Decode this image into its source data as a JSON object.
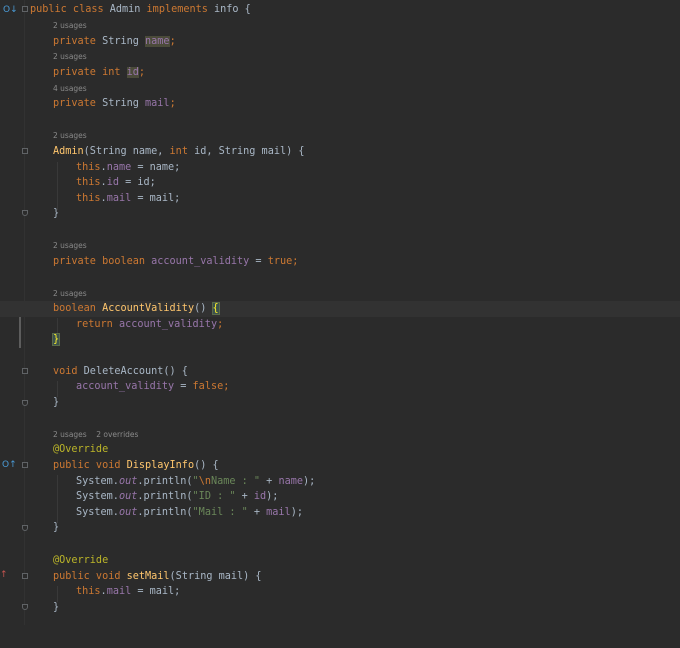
{
  "editor": {
    "hints": {
      "h1": "2 usages",
      "h2": "2 usages",
      "h3": "4 usages",
      "h4": "2 usages",
      "h5": "2 usages",
      "h6": "2 usages",
      "h7": "2 usages    2 overrides"
    },
    "code": {
      "l1_kw1": "public class ",
      "l1_name": "Admin ",
      "l1_kw2": "implements ",
      "l1_rest": "info {",
      "l2_kw": "private ",
      "l2_type": "String ",
      "l2_fld": "name",
      "l2_end": ";",
      "l3_kw": "private int ",
      "l3_fld": "id",
      "l3_end": ";",
      "l4_kw": "private ",
      "l4_type": "String ",
      "l4_fld": "mail",
      "l4_end": ";",
      "l5_fn": "Admin",
      "l5_a": "(String name, ",
      "l5_kw": "int ",
      "l5_b": "id, String mail) {",
      "l6_this": "this",
      "l6_dot": ".",
      "l6_fld": "name",
      "l6_rest": " = name;",
      "l7_this": "this",
      "l7_dot": ".",
      "l7_fld": "id",
      "l7_rest": " = id;",
      "l8_this": "this",
      "l8_dot": ".",
      "l8_fld": "mail",
      "l8_rest": " = mail;",
      "l9": "}",
      "l10_kw": "private boolean ",
      "l10_fld": "account_validity",
      "l10_eq": " = ",
      "l10_val": "true",
      "l10_end": ";",
      "l11_kw": "boolean ",
      "l11_fn": "AccountValidity",
      "l11_a": "() ",
      "l11_brace": "{",
      "l12_kw": "return ",
      "l12_fld": "account_validity",
      "l12_end": ";",
      "l13_brace": "}",
      "l14_kw": "void ",
      "l14_fn": "DeleteAccount",
      "l14_a": "() {",
      "l15_fld": "account_validity",
      "l15_eq": " = ",
      "l15_val": "false",
      "l15_end": ";",
      "l16": "}",
      "l17_ann": "@Override",
      "l18_kw": "public void ",
      "l18_fn": "DisplayInfo",
      "l18_a": "() {",
      "l19_sys": "System.",
      "l19_out": "out",
      "l19_p": ".println(",
      "l19_s1": "\"",
      "l19_esc": "\\n",
      "l19_s2": "Name : \"",
      "l19_rest": " + ",
      "l19_fld": "name",
      "l19_end": ");",
      "l20_sys": "System.",
      "l20_out": "out",
      "l20_p": ".println(",
      "l20_s": "\"ID : \"",
      "l20_rest": " + ",
      "l20_fld": "id",
      "l20_end": ");",
      "l21_sys": "System.",
      "l21_out": "out",
      "l21_p": ".println(",
      "l21_s": "\"Mail : \"",
      "l21_rest": " + ",
      "l21_fld": "mail",
      "l21_end": ");",
      "l22": "}",
      "l23_ann": "@Override",
      "l24_kw": "public void ",
      "l24_fn": "setMail",
      "l24_a": "(String mail) {",
      "l25_this": "this",
      "l25_dot": ".",
      "l25_fld": "mail",
      "l25_rest": " = mail;",
      "l26": "}"
    },
    "markers": {
      "class_impl": "O↓",
      "display_override": "O↑",
      "set_override": "↑"
    },
    "colors": {
      "background": "#2b2b2b",
      "keyword": "#cc7832",
      "field": "#9876aa",
      "string": "#6a8759",
      "method": "#ffc66d",
      "annotation": "#bbb529",
      "text": "#a9b7c6"
    }
  }
}
